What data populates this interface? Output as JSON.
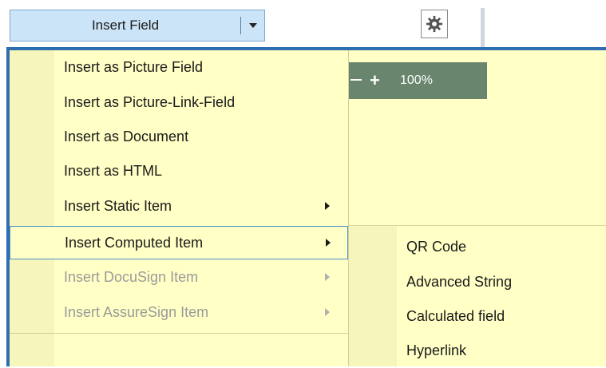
{
  "toolbar": {
    "insert_field_label": "Insert Field",
    "dropdown_icon": "chevron-down-icon",
    "settings_icon": "gear-icon"
  },
  "zoom": {
    "value": "100%"
  },
  "menu": {
    "items": [
      {
        "label": "Insert as Picture Field",
        "enabled": true,
        "submenu": false
      },
      {
        "label": "Insert as Picture-Link-Field",
        "enabled": true,
        "submenu": false
      },
      {
        "label": "Insert as Document",
        "enabled": true,
        "submenu": false
      },
      {
        "label": "Insert as HTML",
        "enabled": true,
        "submenu": false
      },
      {
        "label": "Insert Static Item",
        "enabled": true,
        "submenu": true
      },
      {
        "label": "Insert Computed Item",
        "enabled": true,
        "submenu": true,
        "highlighted": true
      },
      {
        "label": "Insert DocuSign Item",
        "enabled": false,
        "submenu": true
      },
      {
        "label": "Insert AssureSign Item",
        "enabled": false,
        "submenu": true
      }
    ]
  },
  "submenu": {
    "items": [
      {
        "label": "QR Code"
      },
      {
        "label": "Advanced String"
      },
      {
        "label": "Calculated field"
      },
      {
        "label": "Hyperlink"
      }
    ]
  },
  "colors": {
    "menu_background": "#ffffc6",
    "button_background": "#cce4f7",
    "panel_border": "#2d6db0",
    "zoom_bar": "#6a856e"
  }
}
